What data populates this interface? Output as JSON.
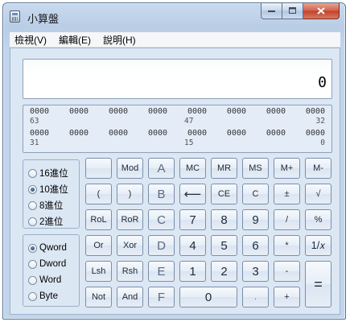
{
  "window": {
    "title": "小算盤"
  },
  "menu": [
    "檢視(V)",
    "編輯(E)",
    "說明(H)"
  ],
  "display": {
    "value": "0"
  },
  "bits": {
    "row1": [
      "0000",
      "0000",
      "0000",
      "0000",
      "0000",
      "0000",
      "0000",
      "0000"
    ],
    "row1_positions": [
      "63",
      "47",
      "32"
    ],
    "row2": [
      "0000",
      "0000",
      "0000",
      "0000",
      "0000",
      "0000",
      "0000",
      "0000"
    ],
    "row2_positions": [
      "31",
      "15",
      "0"
    ]
  },
  "base_options": [
    {
      "label": "16進位",
      "checked": false
    },
    {
      "label": "10進位",
      "checked": true
    },
    {
      "label": "8進位",
      "checked": false
    },
    {
      "label": "2進位",
      "checked": false
    }
  ],
  "word_options": [
    {
      "label": "Qword",
      "checked": true
    },
    {
      "label": "Dword",
      "checked": false
    },
    {
      "label": "Word",
      "checked": false
    },
    {
      "label": "Byte",
      "checked": false
    }
  ],
  "buttons": {
    "blank": "",
    "mod": "Mod",
    "a": "A",
    "mc": "MC",
    "mr": "MR",
    "ms": "MS",
    "mplus": "M+",
    "mminus": "M-",
    "lparen": "(",
    "rparen": ")",
    "b": "B",
    "backspace": "⟵",
    "ce": "CE",
    "c": "C",
    "plusminus": "±",
    "sqrt": "√",
    "rol": "RoL",
    "ror": "RoR",
    "cc": "C",
    "d7": "7",
    "d8": "8",
    "d9": "9",
    "divide": "/",
    "percent": "%",
    "or": "Or",
    "xor": "Xor",
    "d": "D",
    "d4": "4",
    "d5": "5",
    "d6": "6",
    "multiply": "*",
    "reciprocal": "1/𝑥",
    "lsh": "Lsh",
    "rsh": "Rsh",
    "e": "E",
    "d1": "1",
    "d2": "2",
    "d3": "3",
    "minus": "-",
    "not": "Not",
    "and": "And",
    "f": "F",
    "d0": "0",
    "dot": ".",
    "plus": "+",
    "equals": "="
  }
}
